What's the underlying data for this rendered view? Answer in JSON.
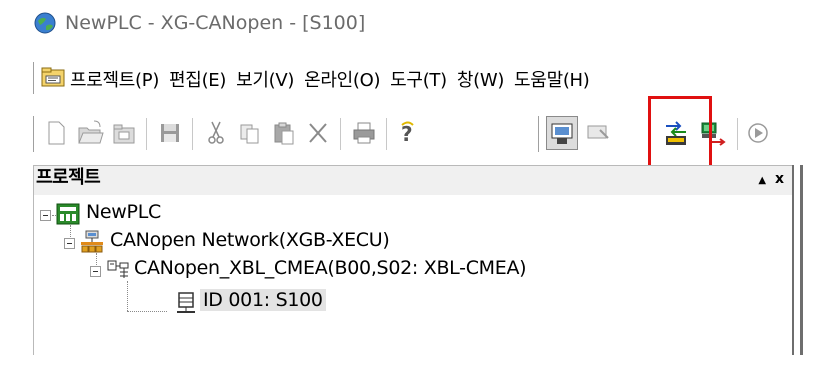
{
  "window": {
    "title": "NewPLC - XG-CANopen - [S100]"
  },
  "menu": {
    "items": [
      {
        "label": "프로젝트(P)"
      },
      {
        "label": "편집(E)"
      },
      {
        "label": "보기(V)"
      },
      {
        "label": "온라인(O)"
      },
      {
        "label": "도구(T)"
      },
      {
        "label": "창(W)"
      },
      {
        "label": "도움말(H)"
      }
    ]
  },
  "toolbar": {
    "buttons": [
      {
        "name": "new-project-icon"
      },
      {
        "name": "open-project-icon"
      },
      {
        "name": "open-folder-icon"
      },
      {
        "name": "save-icon"
      },
      {
        "name": "cut-icon"
      },
      {
        "name": "copy-icon"
      },
      {
        "name": "paste-icon"
      },
      {
        "name": "delete-icon"
      },
      {
        "name": "print-icon"
      },
      {
        "name": "help-icon"
      },
      {
        "name": "connect-icon"
      },
      {
        "name": "disconnect-icon"
      },
      {
        "name": "upload-icon"
      },
      {
        "name": "download-icon"
      },
      {
        "name": "run-icon"
      }
    ],
    "highlight_color": "#e01010"
  },
  "panel": {
    "title": "프로젝트",
    "pin_glyph": "▲",
    "close_glyph": "x"
  },
  "tree": {
    "nodes": [
      {
        "label": "NewPLC",
        "icon": "plc-icon"
      },
      {
        "label": "CANopen Network(XGB-XECU)",
        "icon": "network-icon"
      },
      {
        "label": "CANopen_XBL_CMEA(B00,S02: XBL-CMEA)",
        "icon": "master-module-icon"
      },
      {
        "label": "ID 001: S100",
        "icon": "slave-device-icon",
        "selected": true
      }
    ]
  }
}
